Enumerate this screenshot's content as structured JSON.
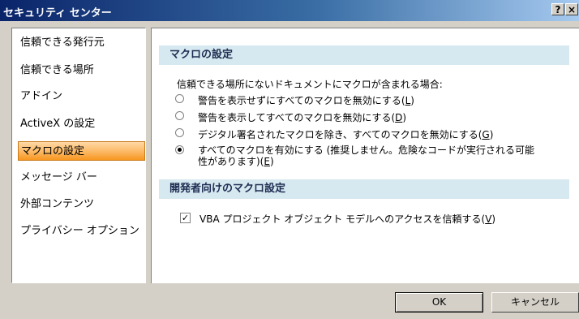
{
  "window": {
    "title": "セキュリティ センター",
    "help_label": "?",
    "close_label": "×"
  },
  "sidebar": {
    "items": [
      {
        "label": "信頼できる発行元",
        "selected": false
      },
      {
        "label": "信頼できる場所",
        "selected": false
      },
      {
        "label": "アドイン",
        "selected": false
      },
      {
        "label": "ActiveX の設定",
        "selected": false
      },
      {
        "label": "マクロの設定",
        "selected": true
      },
      {
        "label": "メッセージ バー",
        "selected": false
      },
      {
        "label": "外部コンテンツ",
        "selected": false
      },
      {
        "label": "プライバシー オプション",
        "selected": false
      }
    ]
  },
  "macro_settings": {
    "header": "マクロの設定",
    "intro": "信頼できる場所にないドキュメントにマクロが含まれる場合:",
    "options": [
      {
        "label": "警告を表示せずにすべてのマクロを無効にする(",
        "key": "L",
        "suffix": ")",
        "checked": false
      },
      {
        "label": "警告を表示してすべてのマクロを無効にする(",
        "key": "D",
        "suffix": ")",
        "checked": false
      },
      {
        "label": "デジタル署名されたマクロを除き、すべてのマクロを無効にする(",
        "key": "G",
        "suffix": ")",
        "checked": false
      },
      {
        "label": "すべてのマクロを有効にする (推奨しません。危険なコードが実行される可能",
        "label2": "性があります)(",
        "key": "E",
        "suffix": ")",
        "checked": true
      }
    ]
  },
  "developer_settings": {
    "header": "開発者向けのマクロ設定",
    "vba_access_label": "VBA プロジェクト オブジェクト モデルへのアクセスを信頼する(",
    "vba_access_key": "V",
    "vba_access_suffix": ")",
    "vba_access_checked": true,
    "check_mark": "✓"
  },
  "buttons": {
    "ok": "OK",
    "cancel": "キャンセル"
  }
}
